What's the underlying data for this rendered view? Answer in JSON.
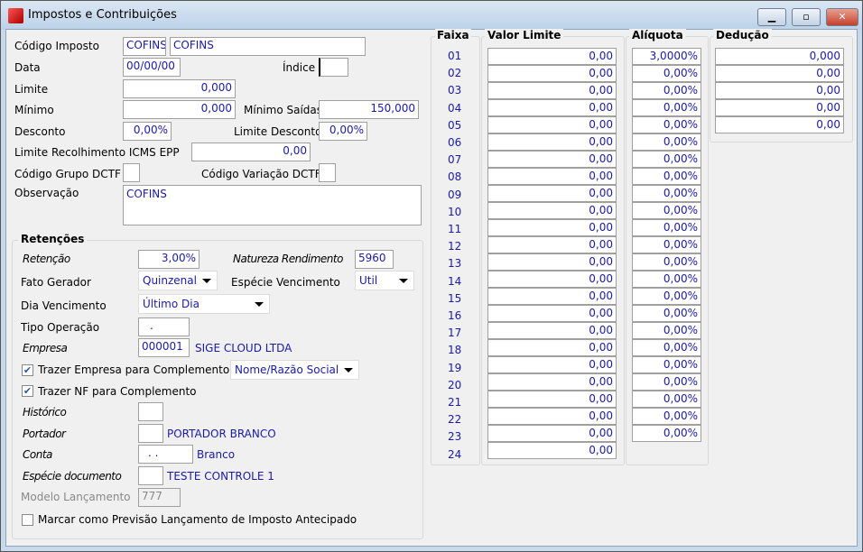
{
  "window": {
    "title": "Impostos e Contribuições",
    "minimize": "▁",
    "maximize": "▫",
    "close": "✕"
  },
  "form": {
    "codigo_label": "Código Imposto",
    "codigo": "COFINS",
    "codigo_desc": "COFINS",
    "data_label": "Data",
    "data": "00/00/00",
    "indice_label": "Índice",
    "indice": "",
    "limite_label": "Limite",
    "limite": "0,000",
    "minimo_label": "Mínimo",
    "minimo": "0,000",
    "minimo_saidas_label": "Mínimo Saídas",
    "minimo_saidas": "150,000",
    "desconto_label": "Desconto",
    "desconto": "0,00%",
    "limite_desconto_label": "Limite Desconto",
    "limite_desconto": "0,00%",
    "icms_label": "Limite Recolhimento ICMS EPP",
    "icms": "0,00",
    "grupo_label": "Código Grupo DCTF",
    "grupo": "",
    "variacao_label": "Código Variação DCTF",
    "variacao": "",
    "obs_label": "Observação",
    "obs": "COFINS"
  },
  "retencoes": {
    "title": "Retenções",
    "retencao_label": "Retenção",
    "retencao": "3,00%",
    "natureza_label": "Natureza Rendimento",
    "natureza": "5960",
    "fato_label": "Fato Gerador",
    "fato": "Quinzenal",
    "especie_venc_label": "Espécie Vencimento",
    "especie_venc": "Util",
    "dia_label": "Dia Vencimento",
    "dia": "Último Dia",
    "tipo_label": "Tipo Operação",
    "tipo": ".",
    "empresa_label": "Empresa",
    "empresa": "000001",
    "empresa_nome": "SIGE CLOUD LTDA",
    "trazer_empresa_label": "Trazer Empresa para Complemento",
    "trazer_empresa": true,
    "trazer_empresa_opt": "Nome/Razão Social",
    "trazer_nf_label": "Trazer NF para Complemento",
    "trazer_nf": true,
    "historico_label": "Histórico",
    "historico": "",
    "portador_label": "Portador",
    "portador": "",
    "portador_nome": "PORTADOR BRANCO",
    "conta_label": "Conta",
    "conta": ". .",
    "conta_nome": "Branco",
    "especie_doc_label": "Espécie documento",
    "especie_doc": "",
    "especie_doc_nome": "TESTE CONTROLE 1",
    "modelo_label": "Modelo Lançamento",
    "modelo": "777",
    "marcar_label": "Marcar como Previsão Lançamento de Imposto Antecipado",
    "marcar": false
  },
  "faixas": {
    "faixa_title": "Faixa",
    "valor_title": "Valor Limite",
    "aliquota_title": "Alíquota",
    "deducao_title": "Dedução",
    "faixa": [
      "01",
      "02",
      "03",
      "04",
      "05",
      "06",
      "07",
      "08",
      "09",
      "10",
      "11",
      "12",
      "13",
      "14",
      "15",
      "16",
      "17",
      "18",
      "19",
      "20",
      "21",
      "22",
      "23",
      "24"
    ],
    "valor": [
      "0,00",
      "0,00",
      "0,00",
      "0,00",
      "0,00",
      "0,00",
      "0,00",
      "0,00",
      "0,00",
      "0,00",
      "0,00",
      "0,00",
      "0,00",
      "0,00",
      "0,00",
      "0,00",
      "0,00",
      "0,00",
      "0,00",
      "0,00",
      "0,00",
      "0,00",
      "0,00",
      "0,00"
    ],
    "aliquota": [
      "3,0000%",
      "0,00%",
      "0,00%",
      "0,00%",
      "0,00%",
      "0,00%",
      "0,00%",
      "0,00%",
      "0,00%",
      "0,00%",
      "0,00%",
      "0,00%",
      "0,00%",
      "0,00%",
      "0,00%",
      "0,00%",
      "0,00%",
      "0,00%",
      "0,00%",
      "0,00%",
      "0,00%",
      "0,00%",
      "0,00%"
    ],
    "deducao": [
      "0,000",
      "0,00",
      "0,00",
      "0,00",
      "0,00"
    ]
  }
}
